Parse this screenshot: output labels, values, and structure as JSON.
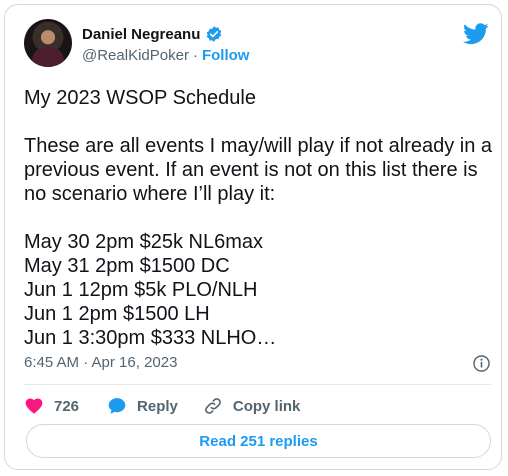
{
  "author": {
    "display_name": "Daniel Negreanu",
    "handle": "@RealKidPoker",
    "separator": "·",
    "follow_label": "Follow",
    "verified": true
  },
  "tweet": {
    "text": "My 2023 WSOP Schedule\n\nThese are all events I may/will play if not already in a previous event. If an event is not on this list there is no scenario where I’ll play it:\n\nMay 30 2pm $25k NL6max\nMay 31 2pm $1500 DC\nJun 1 12pm $5k PLO/NLH\nJun 1 2pm $1500 LH\nJun 1 3:30pm $333 NLHO…",
    "timestamp": "6:45 AM · Apr 16, 2023"
  },
  "actions": {
    "like_count": "726",
    "reply_label": "Reply",
    "copy_link_label": "Copy link"
  },
  "footer": {
    "read_replies_label": "Read 251 replies"
  },
  "colors": {
    "accent": "#1d9bf0",
    "like": "#f91880",
    "text": "#0f1419",
    "muted": "#536471",
    "border": "#cfd9de"
  },
  "icons": {
    "brand": "twitter-bird-icon",
    "verified": "verified-badge-icon",
    "info": "info-icon",
    "like": "heart-icon",
    "reply": "reply-bubble-icon",
    "copy_link": "link-icon"
  }
}
